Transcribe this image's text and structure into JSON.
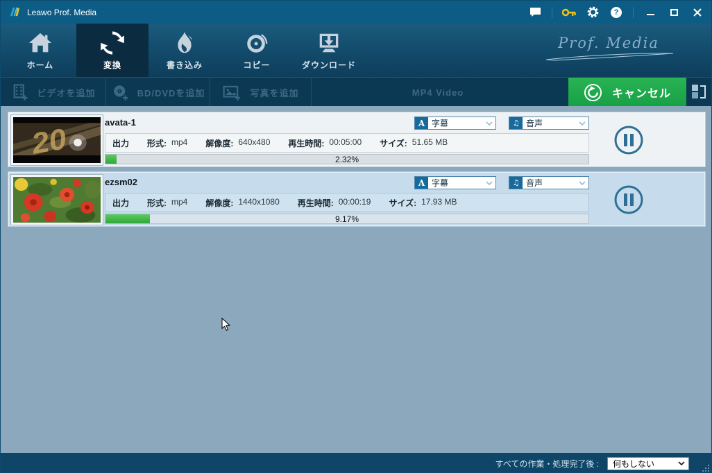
{
  "titlebar": {
    "title": "Leawo Prof. Media"
  },
  "nav": {
    "tabs": [
      {
        "id": "home",
        "label": "ホーム"
      },
      {
        "id": "convert",
        "label": "変換"
      },
      {
        "id": "burn",
        "label": "書き込み"
      },
      {
        "id": "copy",
        "label": "コピー"
      },
      {
        "id": "download",
        "label": "ダウンロード"
      }
    ],
    "brand": "Prof. Media"
  },
  "toolbar": {
    "add_video": "ビデオを追加",
    "add_bd_dvd": "BD/DVDを追加",
    "add_photo": "写真を追加",
    "profile": "MP4 Video",
    "cancel_label": "キャンセル"
  },
  "icons": {
    "subtitle_glyph": "A",
    "audio_glyph": "♫",
    "help_glyph": "?"
  },
  "tasks": [
    {
      "name": "avata-1",
      "subtitle_dropdown": "字幕",
      "audio_dropdown": "音声",
      "output_label": "出力",
      "format_label": "形式:",
      "format_value": "mp4",
      "resolution_label": "解像度:",
      "resolution_value": "640x480",
      "duration_label": "再生時間:",
      "duration_value": "00:05:00",
      "size_label": "サイズ:",
      "size_value": "51.65 MB",
      "progress_label": "2.32%",
      "progress_percent": 2.32
    },
    {
      "name": "ezsm02",
      "subtitle_dropdown": "字幕",
      "audio_dropdown": "音声",
      "output_label": "出力",
      "format_label": "形式:",
      "format_value": "mp4",
      "resolution_label": "解像度:",
      "resolution_value": "1440x1080",
      "duration_label": "再生時間:",
      "duration_value": "00:00:19",
      "size_label": "サイズ:",
      "size_value": "17.93 MB",
      "progress_label": "9.17%",
      "progress_percent": 9.17
    }
  ],
  "statusbar": {
    "after_label": "すべての作業・処理完了後 :",
    "selected_option": "何もしない"
  },
  "colors": {
    "accent_green": "#21ab4e",
    "progress_green": "#3fb447",
    "pause_blue": "#2e7095",
    "titlebar_blue": "#0d5c86"
  }
}
